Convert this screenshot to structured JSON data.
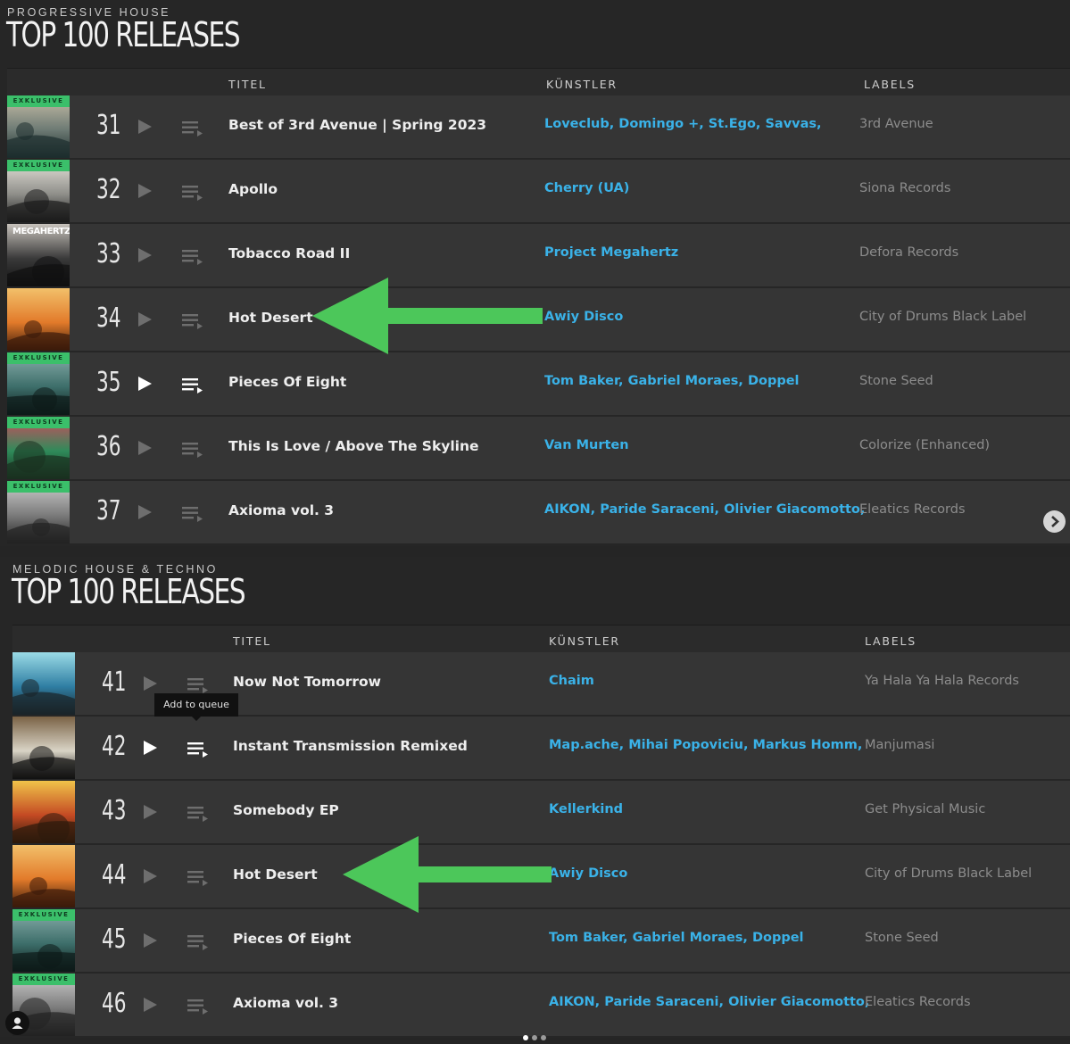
{
  "sections": [
    {
      "subtitle": "PROGRESSIVE HOUSE",
      "title": "TOP 100 RELEASES",
      "columns": {
        "title": "TITEL",
        "artist": "KÜNSTLER",
        "labels": "LABELS"
      },
      "rows": [
        {
          "rank": "31",
          "title": "Best of 3rd Avenue | Spring 2023",
          "artists": "Loveclub, Domingo +, St.Ego, Savvas,",
          "label": "3rd Avenue",
          "exclusive": true
        },
        {
          "rank": "32",
          "title": "Apollo",
          "artists": "Cherry (UA)",
          "label": "Siona Records",
          "exclusive": true
        },
        {
          "rank": "33",
          "title": "Tobacco Road II",
          "artists": "Project Megahertz",
          "label": "Defora Records",
          "exclusive": false,
          "art_text": "MEGAHERTZ"
        },
        {
          "rank": "34",
          "title": "Hot Desert",
          "artists": "Awiy Disco",
          "label": "City of Drums Black Label",
          "exclusive": false
        },
        {
          "rank": "35",
          "title": "Pieces Of Eight",
          "artists": "Tom Baker, Gabriel Moraes, Doppel",
          "label": "Stone Seed",
          "exclusive": true,
          "hover": true
        },
        {
          "rank": "36",
          "title": "This Is Love / Above The Skyline",
          "artists": "Van Murten",
          "label": "Colorize (Enhanced)",
          "exclusive": true
        },
        {
          "rank": "37",
          "title": "Axioma vol. 3",
          "artists": "AIKON, Paride Saraceni, Olivier Giacomotto,",
          "label": "Eleatics Records",
          "exclusive": true
        }
      ]
    },
    {
      "subtitle": "MELODIC HOUSE & TECHNO",
      "title": "TOP 100 RELEASES",
      "columns": {
        "title": "TITEL",
        "artist": "KÜNSTLER",
        "labels": "LABELS"
      },
      "rows": [
        {
          "rank": "41",
          "title": "Now Not Tomorrow",
          "artists": "Chaim",
          "label": "Ya Hala Ya Hala Records",
          "exclusive": false
        },
        {
          "rank": "42",
          "title": "Instant Transmission Remixed",
          "artists": "Map.ache, Mihai Popoviciu, Markus Homm,",
          "label": "Manjumasi",
          "exclusive": false,
          "hover": true
        },
        {
          "rank": "43",
          "title": "Somebody EP",
          "artists": "Kellerkind",
          "label": "Get Physical Music",
          "exclusive": false
        },
        {
          "rank": "44",
          "title": "Hot Desert",
          "artists": "Awiy Disco",
          "label": "City of Drums Black Label",
          "exclusive": false
        },
        {
          "rank": "45",
          "title": "Pieces Of Eight",
          "artists": "Tom Baker, Gabriel Moraes, Doppel",
          "label": "Stone Seed",
          "exclusive": true
        },
        {
          "rank": "46",
          "title": "Axioma vol. 3",
          "artists": "AIKON, Paride Saraceni, Olivier Giacomotto,",
          "label": "Eleatics Records",
          "exclusive": true
        }
      ]
    }
  ],
  "exclusive_badge": "EXKLUSIVE",
  "tooltip": "Add to queue",
  "annotations": [
    {
      "name": "green-arrow",
      "points_to_rank": "34",
      "color": "#4cc75a"
    },
    {
      "name": "green-arrow",
      "points_to_rank": "44",
      "color": "#4cc75a"
    }
  ],
  "colors": {
    "artist": "#3ab2e8",
    "exclusive": "#3bbf6a",
    "arrow": "#4cc75a"
  },
  "carousel": {
    "pages": 3,
    "active": 0
  },
  "icons": [
    "play-icon",
    "queue-icon",
    "chevron-right-icon",
    "user-icon"
  ]
}
